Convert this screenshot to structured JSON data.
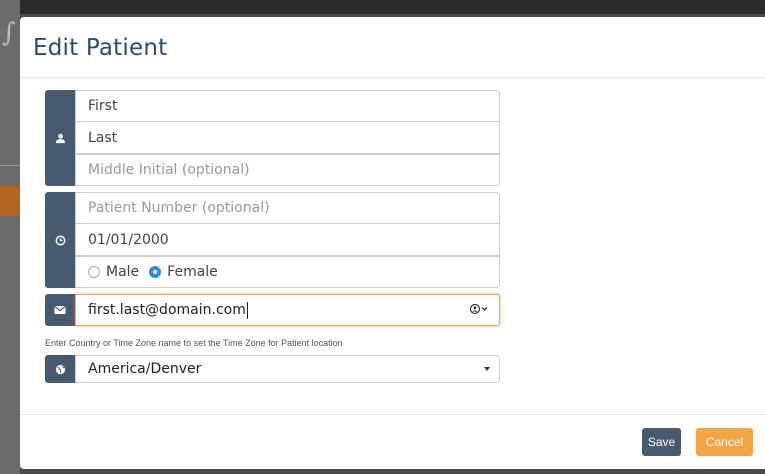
{
  "modal": {
    "title": "Edit Patient"
  },
  "name_group": {
    "icon": "user-icon",
    "first": {
      "value": "First",
      "placeholder": ""
    },
    "last": {
      "value": "Last",
      "placeholder": ""
    },
    "middle": {
      "value": "",
      "placeholder": "Middle Initial (optional)"
    }
  },
  "details_group": {
    "icon": "clock-icon",
    "patient_number": {
      "value": "",
      "placeholder": "Patient Number (optional)"
    },
    "dob": {
      "value": "01/01/2000"
    },
    "gender": {
      "options": [
        "Male",
        "Female"
      ],
      "selected": "Female"
    }
  },
  "email_group": {
    "icon": "envelope-icon",
    "email": {
      "value": "first.last@domain.com"
    },
    "contact_button_icon": "contact-dropdown-icon"
  },
  "timezone": {
    "hint": "Enter Country or Time Zone name to set the Time Zone for Patient location",
    "icon": "globe-icon",
    "value": "America/Denver"
  },
  "footer": {
    "save_label": "Save",
    "cancel_label": "Cancel"
  },
  "colors": {
    "accent": "#475b6f",
    "title": "#2e4a6b",
    "cancel": "#f5a445",
    "radio_selected": "#2f8ae0",
    "focus_border": "#f0a35a"
  }
}
